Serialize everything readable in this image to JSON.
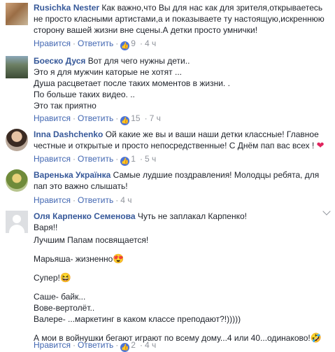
{
  "comments": [
    {
      "author": "Rusichka Nester",
      "lines": [
        "Как важно,что Вы для нас как для зрителя,открываетесь",
        "не просто класными артистами,а и показываете ту настоящую,искреннюю",
        "сторону вашей жизни вне сцены.А детки просто умнички!"
      ],
      "like": "Нравится",
      "reply": "Ответить",
      "likes": "9",
      "time": "4 ч"
    },
    {
      "author": "Боеско Дуся",
      "lines": [
        "Вот для чего нужны дети..",
        "Это я для мужчин каторые не хотят ...",
        "Душа расцветает после таких моментов в жизни. .",
        "По больше таких видео. ..",
        "Это так приятно"
      ],
      "like": "Нравится",
      "reply": "Ответить",
      "likes": "15",
      "time": "7 ч"
    },
    {
      "author": "Inna Dashchenko",
      "lines": [
        "Ой какие же вы и ваши наши детки классные! Главное",
        "честные и открытые и просто непосредственные! С Днём пап вас всех !"
      ],
      "emoji": "❤",
      "like": "Нравится",
      "reply": "Ответить",
      "likes": "1",
      "time": "5 ч"
    },
    {
      "author": "Варенька Українка",
      "lines": [
        "Самые лудшие поздравления! Молодцы ребята, для",
        "пап это важно слышать!"
      ],
      "like": "Нравится",
      "reply": "Ответить",
      "time": "4 ч"
    },
    {
      "author": "Оля Карпенко Семенова",
      "lines": [
        "Чуть не заплакал Карпенко!",
        "Варя!!",
        "Лучшим Папам посвящается!",
        "",
        "Марьяша- жизненно",
        "",
        "Супер!",
        "",
        "Саше- байк...",
        "Вове-вертолёт..",
        "Валере- ...маркетинг в каком классе преподают?!)))))",
        "",
        "А мои в войнушки бегают играют по всему дому...4 или 40...одинаково!"
      ],
      "emojis": {
        "line5": "😍",
        "line7": "😆",
        "line13": "🤣"
      },
      "like": "Нравится",
      "reply": "Ответить",
      "likes": "2",
      "time": "4 ч"
    }
  ]
}
